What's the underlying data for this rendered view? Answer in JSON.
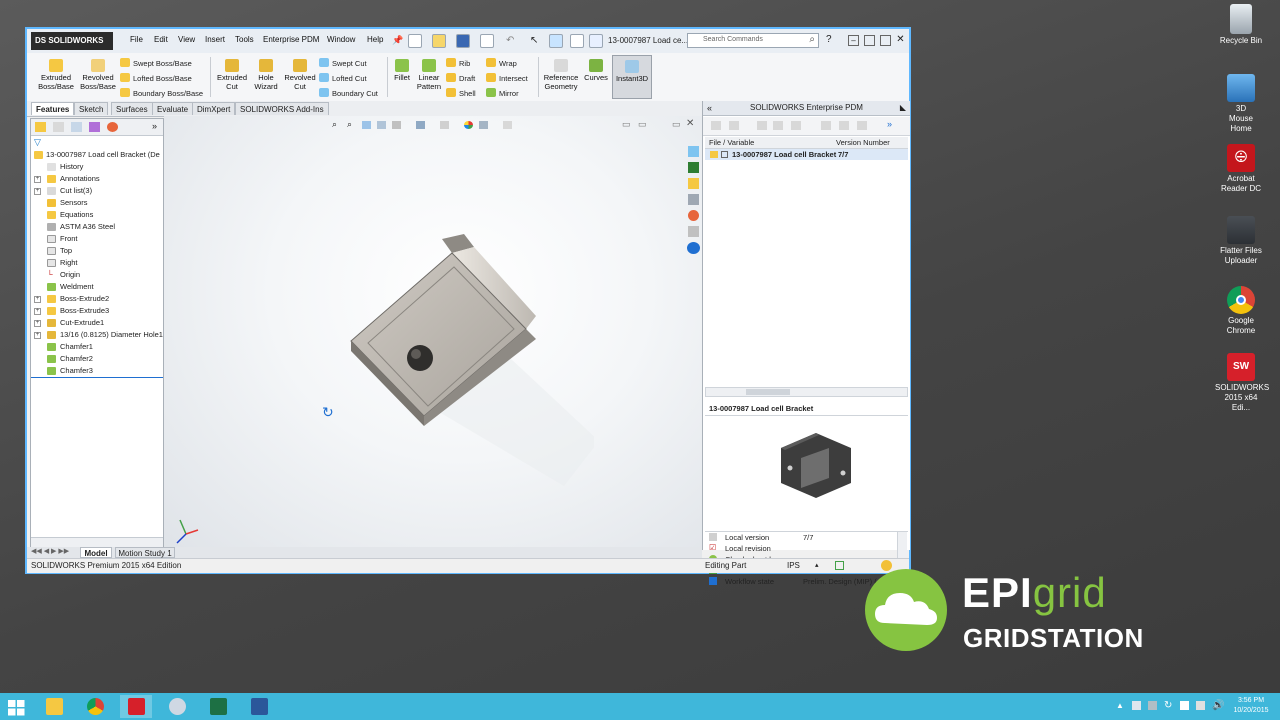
{
  "desktop": {
    "icons": [
      {
        "label": "Recycle Bin"
      },
      {
        "label": "3D Mouse Home"
      },
      {
        "label": "Acrobat Reader DC"
      },
      {
        "label": "Flatter Files Uploader"
      },
      {
        "label": "Google Chrome"
      },
      {
        "label": "SOLIDWORKS 2015 x64 Edi..."
      }
    ]
  },
  "titlebar": {
    "logo": "SOLIDWORKS",
    "menus": [
      "File",
      "Edit",
      "View",
      "Insert",
      "Tools",
      "Enterprise PDM",
      "Window",
      "Help"
    ],
    "doc_name": "13-0007987 Load ce...",
    "search_placeholder": "Search Commands"
  },
  "ribbon": {
    "large_buttons": [
      {
        "label": "Extruded\nBoss/Base"
      },
      {
        "label": "Revolved\nBoss/Base"
      },
      {
        "label": "Extruded\nCut"
      },
      {
        "label": "Hole\nWizard"
      },
      {
        "label": "Revolved\nCut"
      },
      {
        "label": "Fillet"
      },
      {
        "label": "Linear\nPattern"
      },
      {
        "label": "Reference\nGeometry"
      },
      {
        "label": "Curves"
      },
      {
        "label": "Instant3D"
      }
    ],
    "small_buttons": [
      {
        "label": "Swept Boss/Base"
      },
      {
        "label": "Lofted Boss/Base"
      },
      {
        "label": "Boundary Boss/Base"
      },
      {
        "label": "Swept Cut"
      },
      {
        "label": "Lofted Cut"
      },
      {
        "label": "Boundary Cut"
      },
      {
        "label": "Rib"
      },
      {
        "label": "Draft"
      },
      {
        "label": "Shell"
      },
      {
        "label": "Wrap"
      },
      {
        "label": "Intersect"
      },
      {
        "label": "Mirror"
      }
    ]
  },
  "command_tabs": [
    "Features",
    "Sketch",
    "Surfaces",
    "Evaluate",
    "DimXpert",
    "SOLIDWORKS Add-Ins"
  ],
  "feature_tree": {
    "root": "13-0007987 Load cell Bracket  (De",
    "items": [
      {
        "label": "History"
      },
      {
        "label": "Annotations"
      },
      {
        "label": "Cut list(3)"
      },
      {
        "label": "Sensors"
      },
      {
        "label": "Equations"
      },
      {
        "label": "ASTM A36 Steel"
      },
      {
        "label": "Front"
      },
      {
        "label": "Top"
      },
      {
        "label": "Right"
      },
      {
        "label": "Origin"
      },
      {
        "label": "Weldment"
      },
      {
        "label": "Boss-Extrude2"
      },
      {
        "label": "Boss-Extrude3"
      },
      {
        "label": "Cut-Extrude1"
      },
      {
        "label": "13/16 (0.8125) Diameter Hole1"
      },
      {
        "label": "Chamfer1"
      },
      {
        "label": "Chamfer2"
      },
      {
        "label": "Chamfer3"
      }
    ]
  },
  "model_tabs": [
    "Model",
    "Motion Study 1"
  ],
  "pdm": {
    "title": "SOLIDWORKS Enterprise PDM",
    "col_file": "File / Variable",
    "col_version": "Version Number",
    "row_file": "13-0007987 Load cell Bracket",
    "row_version": "7/7",
    "preview_title": "13-0007987 Load cell Bracket",
    "props": [
      {
        "label": "Local version",
        "value": "7/7"
      },
      {
        "label": "Local revision",
        "value": ""
      },
      {
        "label": "Checked out by",
        "value": ""
      },
      {
        "label": "Checked out in",
        "value": ""
      },
      {
        "label": "Workflow state",
        "value": "Prelim. Design (MIP) (..."
      }
    ]
  },
  "statusbar": {
    "edition": "SOLIDWORKS Premium 2015 x64 Edition",
    "mode": "Editing Part",
    "units": "IPS"
  },
  "branding": {
    "epi": "EPI",
    "grid": "grid",
    "gridstation": "GRIDSTATION"
  },
  "taskbar": {
    "time": "3:56 PM",
    "date": "10/20/2015"
  }
}
